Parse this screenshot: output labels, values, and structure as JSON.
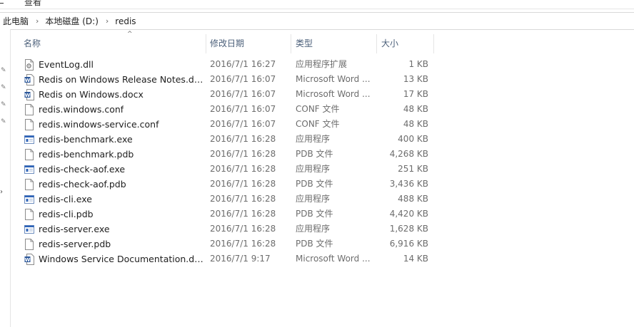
{
  "menu": {
    "view_label": "查看"
  },
  "breadcrumb": [
    {
      "label": "此电脑"
    },
    {
      "label": "本地磁盘 (D:)"
    },
    {
      "label": "redis"
    }
  ],
  "columns": {
    "name": "名称",
    "date": "修改日期",
    "type": "类型",
    "size": "大小"
  },
  "files": [
    {
      "name": "EventLog.dll",
      "date": "2016/7/1 16:27",
      "type": "应用程序扩展",
      "size": "1 KB",
      "icon": "dll-icon"
    },
    {
      "name": "Redis on Windows Release Notes.do...",
      "date": "2016/7/1 16:07",
      "type": "Microsoft Word ...",
      "size": "13 KB",
      "icon": "word-icon"
    },
    {
      "name": "Redis on Windows.docx",
      "date": "2016/7/1 16:07",
      "type": "Microsoft Word ...",
      "size": "17 KB",
      "icon": "word-icon"
    },
    {
      "name": "redis.windows.conf",
      "date": "2016/7/1 16:07",
      "type": "CONF 文件",
      "size": "48 KB",
      "icon": "file-icon"
    },
    {
      "name": "redis.windows-service.conf",
      "date": "2016/7/1 16:07",
      "type": "CONF 文件",
      "size": "48 KB",
      "icon": "file-icon"
    },
    {
      "name": "redis-benchmark.exe",
      "date": "2016/7/1 16:28",
      "type": "应用程序",
      "size": "400 KB",
      "icon": "exe-icon"
    },
    {
      "name": "redis-benchmark.pdb",
      "date": "2016/7/1 16:28",
      "type": "PDB 文件",
      "size": "4,268 KB",
      "icon": "file-icon"
    },
    {
      "name": "redis-check-aof.exe",
      "date": "2016/7/1 16:28",
      "type": "应用程序",
      "size": "251 KB",
      "icon": "exe-icon"
    },
    {
      "name": "redis-check-aof.pdb",
      "date": "2016/7/1 16:28",
      "type": "PDB 文件",
      "size": "3,436 KB",
      "icon": "file-icon"
    },
    {
      "name": "redis-cli.exe",
      "date": "2016/7/1 16:28",
      "type": "应用程序",
      "size": "488 KB",
      "icon": "exe-icon"
    },
    {
      "name": "redis-cli.pdb",
      "date": "2016/7/1 16:28",
      "type": "PDB 文件",
      "size": "4,420 KB",
      "icon": "file-icon"
    },
    {
      "name": "redis-server.exe",
      "date": "2016/7/1 16:28",
      "type": "应用程序",
      "size": "1,628 KB",
      "icon": "exe-icon"
    },
    {
      "name": "redis-server.pdb",
      "date": "2016/7/1 16:28",
      "type": "PDB 文件",
      "size": "6,916 KB",
      "icon": "file-icon"
    },
    {
      "name": "Windows Service Documentation.docx",
      "date": "2016/7/1 9:17",
      "type": "Microsoft Word ...",
      "size": "14 KB",
      "icon": "word-icon"
    }
  ],
  "colors": {
    "header_text": "#4c607a",
    "secondary_text": "#6d6d6d",
    "word_blue": "#2b579a",
    "exe_blue": "#2f64b8"
  }
}
